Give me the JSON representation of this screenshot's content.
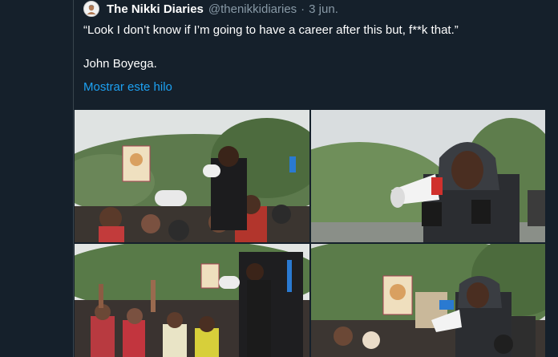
{
  "tweet": {
    "author_name": "The Nikki Diaries",
    "author_handle": "@thenikkidiaries",
    "separator": "·",
    "date": "3 jun.",
    "quote": "“Look I don’t know if I’m going to have a career after this but, f**k that.”",
    "attribution": "John Boyega.",
    "show_thread_label": "Mostrar este hilo",
    "link_color": "#1da1f2"
  },
  "media": [
    {
      "icon": "protest-crowd-photo"
    },
    {
      "icon": "megaphone-speech-photo"
    },
    {
      "icon": "raised-fists-crowd-photo"
    },
    {
      "icon": "crowd-megaphone-photo"
    }
  ],
  "colors": {
    "background": "#15202b",
    "text": "#ffffff",
    "muted": "#8899a6",
    "border": "#38444d"
  }
}
